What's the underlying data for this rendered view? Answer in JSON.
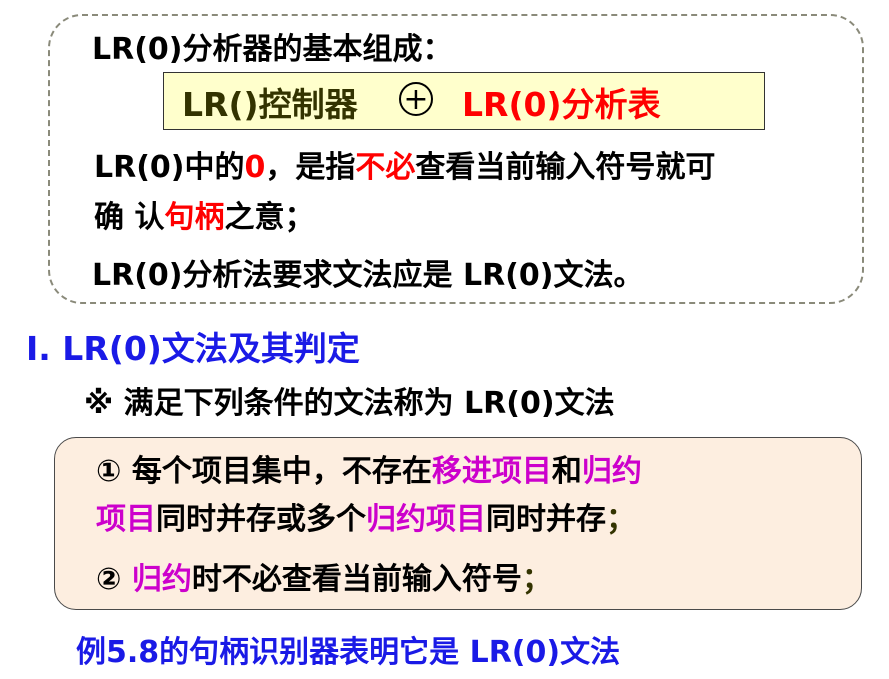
{
  "top_box": {
    "heading": "LR(0)分析器的基本组成：",
    "formula": {
      "left": "LR()控制器",
      "plus": "+",
      "right": "LR(0)分析表"
    },
    "note_line1": {
      "a": "LR(0)中的",
      "zero": "0",
      "b": "，是指",
      "not_need": "不必",
      "c": "查看当前输入符号就可"
    },
    "note_line2": {
      "a": "确 认",
      "handle": "句柄",
      "b": "之意；"
    },
    "requirement": "LR(0)分析法要求文法应是 LR(0)文法。"
  },
  "section": {
    "title": "I. LR(0)文法及其判定",
    "intro": "※ 满足下列条件的文法称为 LR(0)文法"
  },
  "conditions": {
    "c1_line1": {
      "num": "①",
      "a": "每个项目集中，不存在",
      "shift": "移进项目",
      "b": "和",
      "reduce": "归约"
    },
    "c1_line2": {
      "items": "项目",
      "a": "同时并存或多个",
      "reduce_items": "归约项目",
      "b": "同时并存",
      "end": "；"
    },
    "c2": {
      "num": "②",
      "reduce": "归约",
      "a": "时不必查看当前输入符号",
      "end": "；"
    }
  },
  "example": "例5.8的句柄识别器表明它是 LR(0)文法"
}
